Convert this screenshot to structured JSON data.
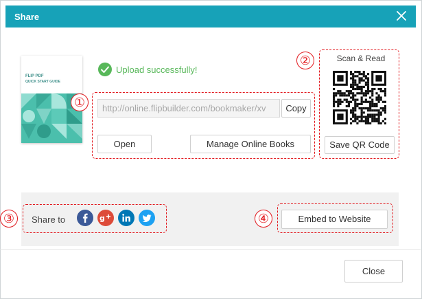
{
  "dialog": {
    "title": "Share"
  },
  "cover": {
    "title_line1": "FLIP PDF",
    "title_line2": "QUICK START GUIDE"
  },
  "upload": {
    "status": "Upload successfully!"
  },
  "link": {
    "url": "http://online.flipbuilder.com/bookmaker/xv",
    "copy_label": "Copy"
  },
  "actions": {
    "open_label": "Open",
    "manage_label": "Manage Online Books"
  },
  "qr": {
    "scan_label": "Scan & Read",
    "save_label": "Save QR Code"
  },
  "share": {
    "label": "Share to",
    "networks": [
      "facebook",
      "google-plus",
      "linkedin",
      "twitter"
    ]
  },
  "embed": {
    "label": "Embed to Website"
  },
  "footer": {
    "close_label": "Close"
  },
  "callouts": [
    "①",
    "②",
    "③",
    "④"
  ],
  "colors": {
    "title_bar": "#17a2b8",
    "success": "#58b85a",
    "callout": "#e2181d",
    "cover_teal": "#4bbfac"
  }
}
